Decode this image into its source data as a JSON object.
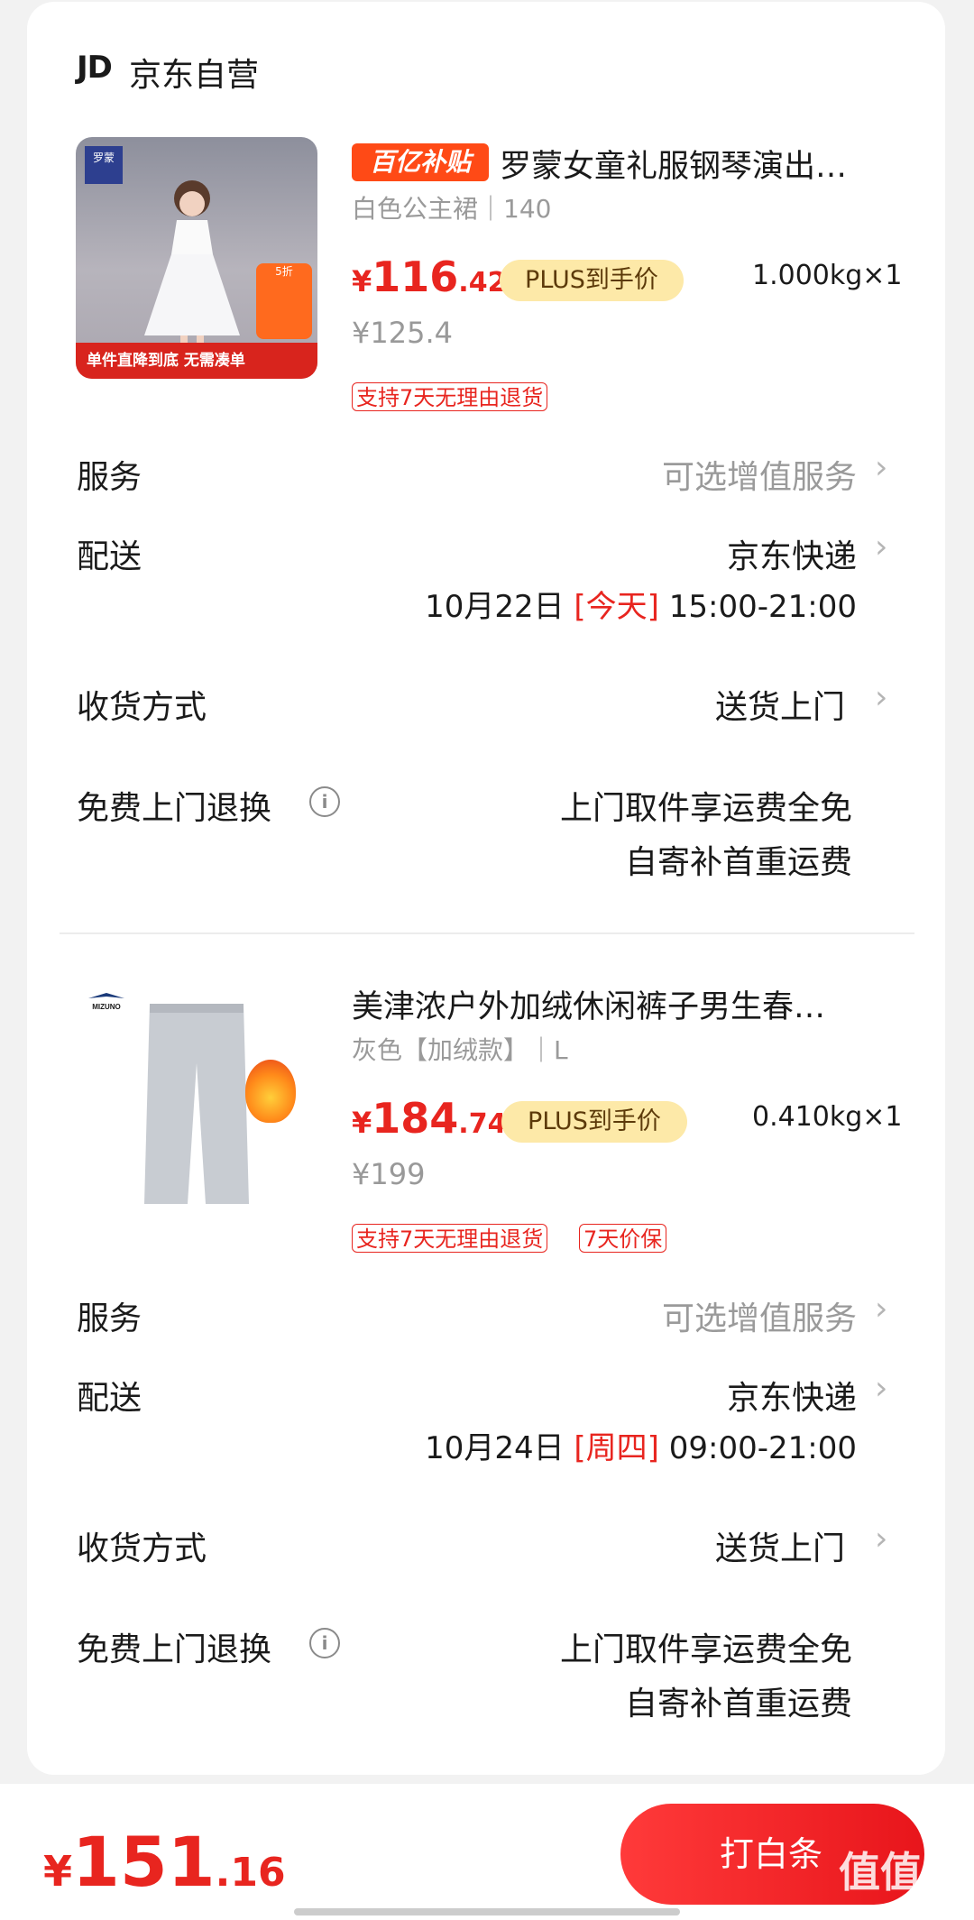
{
  "shop": {
    "logo": "JD",
    "name": "京东自营"
  },
  "items": [
    {
      "badge": "百亿补贴",
      "title": "罗蒙女童礼服钢琴演出…",
      "spec": "白色公主裙｜140",
      "price_currency": "¥",
      "price_int": "116",
      "price_dec": ".42",
      "plus_label": "PLUS到手价",
      "weight": "1.000kg×1",
      "original_price": "¥125.4",
      "tags": [
        "支持7天无理由退货"
      ],
      "thumb": {
        "brand": "罗蒙\nROMON",
        "promo_bar": "单件直降到底 无需凑单"
      },
      "service": {
        "label": "服务",
        "value": "可选增值服务"
      },
      "delivery": {
        "label": "配送",
        "value": "京东快递",
        "date": "10月22日",
        "day": "[今天]",
        "time": "15:00-21:00"
      },
      "receive": {
        "label": "收货方式",
        "value": "送货上门"
      },
      "returns": {
        "label": "免费上门退换",
        "line1": "上门取件享运费全免",
        "line2": "自寄补首重运费"
      }
    },
    {
      "badge": "",
      "title": "美津浓户外加绒休闲裤子男生春…",
      "spec": "灰色【加绒款】｜L",
      "price_currency": "¥",
      "price_int": "184",
      "price_dec": ".74",
      "plus_label": "PLUS到手价",
      "weight": "0.410kg×1",
      "original_price": "¥199",
      "tags": [
        "支持7天无理由退货",
        "7天价保"
      ],
      "service": {
        "label": "服务",
        "value": "可选增值服务"
      },
      "delivery": {
        "label": "配送",
        "value": "京东快递",
        "date": "10月24日",
        "day": "[周四]",
        "time": "09:00-21:00"
      },
      "receive": {
        "label": "收货方式",
        "value": "送货上门"
      },
      "returns": {
        "label": "免费上门退换",
        "line1": "上门取件享运费全免",
        "line2": "自寄补首重运费"
      }
    }
  ],
  "footer": {
    "total_currency": "¥",
    "total_int": "151",
    "total_dec": ".16",
    "pay_button": "打白条",
    "watermark": "值值值",
    "watermark_url": "zhizhizhi.com"
  },
  "icons": {
    "chevron": "chevron-right-icon",
    "info": "info-icon"
  },
  "colors": {
    "accent": "#e8251f",
    "plus_bg": "#fde9a8",
    "subsidy": "#ff4a16"
  }
}
